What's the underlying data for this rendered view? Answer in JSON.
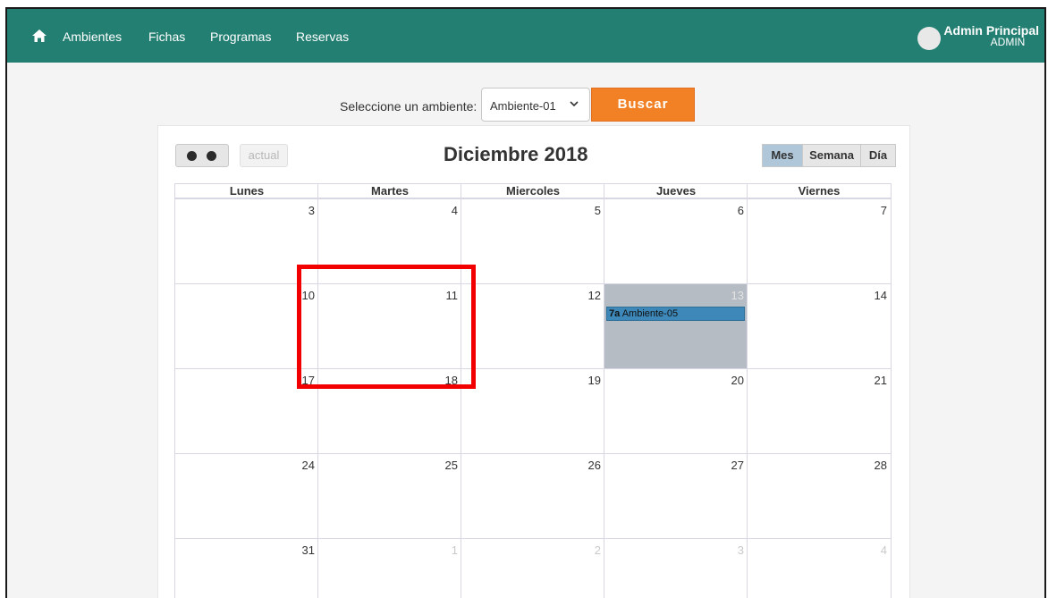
{
  "navbar": {
    "home_icon": "home-icon",
    "links": [
      "Ambientes",
      "Fichas",
      "Programas",
      "Reservas"
    ],
    "user_name": "Admin Principal",
    "user_role": "ADMIN",
    "color": "#237f72"
  },
  "filter": {
    "label": "Seleccione un ambiente:",
    "selected": "Ambiente-01",
    "search_label": "Buscar",
    "search_color": "#f28125"
  },
  "calendar": {
    "today_label": "actual",
    "title": "Diciembre 2018",
    "views": [
      "Mes",
      "Semana",
      "Día"
    ],
    "active_view": "Mes",
    "weekdays": [
      "Lunes",
      "Martes",
      "Miercoles",
      "Jueves",
      "Viernes"
    ],
    "weeks": [
      [
        "3",
        "4",
        "5",
        "6",
        "7"
      ],
      [
        "10",
        "11",
        "12",
        "13",
        "14"
      ],
      [
        "17",
        "18",
        "19",
        "20",
        "21"
      ],
      [
        "24",
        "25",
        "26",
        "27",
        "28"
      ],
      [
        "31",
        "1",
        "2",
        "3",
        "4"
      ]
    ],
    "today": "13",
    "event": {
      "time": "7a",
      "title": "Ambiente-05"
    },
    "highlight_color": "#f20000"
  }
}
